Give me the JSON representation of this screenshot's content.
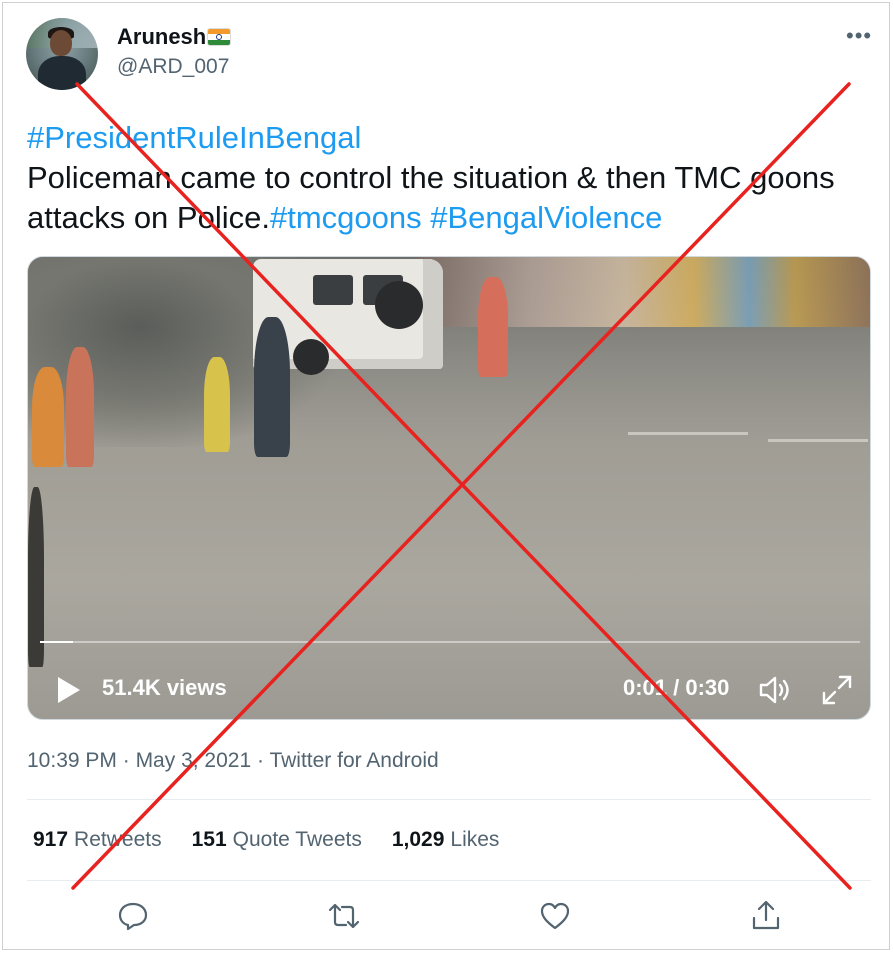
{
  "tweet": {
    "author_name": "Arunesh",
    "author_handle": "@ARD_007",
    "more_label": "•••",
    "text_parts": {
      "hashtag_1": "#PresidentRuleInBengal",
      "body": "Policeman came to control the situation & then TMC goons attacks on Police.",
      "hashtag_2": "#tmcgoons",
      "hashtag_3": "#BengalViolence"
    },
    "video": {
      "views": "51.4K views",
      "time": "0:01 / 0:30",
      "progress": 0.04
    },
    "meta": {
      "time": "10:39 PM",
      "separator": " · ",
      "date": "May 3, 2021",
      "source": "Twitter for Android"
    },
    "stats": [
      {
        "count": "917",
        "label": "Retweets"
      },
      {
        "count": "151",
        "label": "Quote Tweets"
      },
      {
        "count": "1,029",
        "label": "Likes"
      }
    ]
  },
  "icons": [
    "reply-icon",
    "retweet-icon",
    "like-icon",
    "share-icon",
    "play-icon",
    "volume-icon",
    "fullscreen-icon",
    "india-flag-icon"
  ],
  "colors": {
    "hashtag": "#1d9bf0",
    "secondary_text": "#536471",
    "cross_mark": "#e8231f"
  }
}
